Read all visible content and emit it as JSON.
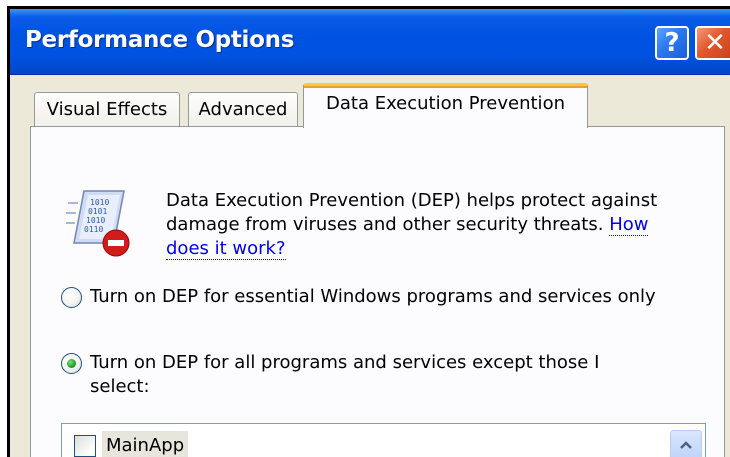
{
  "window": {
    "title": "Performance Options",
    "help_icon": "help-icon",
    "close_icon": "close-icon",
    "help_glyph": "?",
    "close_glyph": "✕"
  },
  "tabs": [
    {
      "label": "Visual Effects",
      "selected": false
    },
    {
      "label": "Advanced",
      "selected": false
    },
    {
      "label": "Data Execution Prevention",
      "selected": true
    }
  ],
  "dep": {
    "icon": "dep-shield-icon",
    "description": "Data Execution Prevention (DEP) helps protect against damage from viruses and other security threats.",
    "link_text": "How does it work?",
    "options": [
      {
        "label": "Turn on DEP for essential Windows programs and services only",
        "checked": false
      },
      {
        "label": "Turn on DEP for all programs and services except those I select:",
        "checked": true
      }
    ],
    "exceptions": [
      {
        "name": "MainApp",
        "checked": false
      }
    ]
  },
  "colors": {
    "titlebar": "#0053e2",
    "close_button": "#e2562b",
    "tab_highlight": "#ffc83c",
    "link": "#0000ee",
    "radio_checked": "#21a121"
  }
}
